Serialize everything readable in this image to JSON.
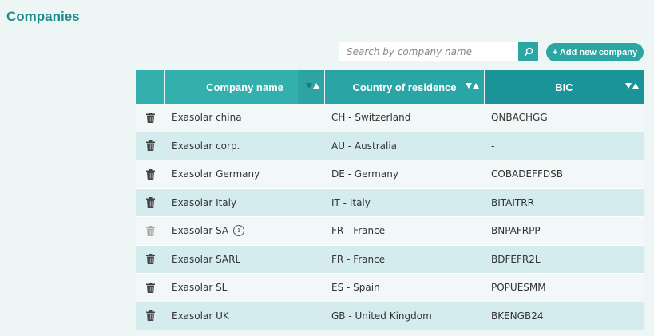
{
  "page": {
    "title": "Companies"
  },
  "toolbar": {
    "search_placeholder": "Search by company name",
    "add_label": "+ Add new company"
  },
  "colors": {
    "accent": "#2aa6a3",
    "title": "#1d8a8c",
    "row_alt": "#d5ecee",
    "row": "#f2f8f8"
  },
  "table": {
    "headers": {
      "name": "Company name",
      "country": "Country of residence",
      "bic": "BIC"
    },
    "rows": [
      {
        "name": "Exasolar china",
        "country": "CH - Switzerland",
        "bic": "QNBACHGG",
        "deletable": true,
        "info": false
      },
      {
        "name": "Exasolar corp.",
        "country": "AU - Australia",
        "bic": "-",
        "deletable": true,
        "info": false
      },
      {
        "name": "Exasolar Germany",
        "country": "DE - Germany",
        "bic": "COBADEFFDSB",
        "deletable": true,
        "info": false
      },
      {
        "name": "Exasolar Italy",
        "country": "IT - Italy",
        "bic": "BITAITRR",
        "deletable": true,
        "info": false
      },
      {
        "name": "Exasolar SA",
        "country": "FR - France",
        "bic": "BNPAFRPP",
        "deletable": false,
        "info": true
      },
      {
        "name": "Exasolar SARL",
        "country": "FR - France",
        "bic": "BDFEFR2L",
        "deletable": true,
        "info": false
      },
      {
        "name": "Exasolar SL",
        "country": "ES - Spain",
        "bic": "POPUESMM",
        "deletable": true,
        "info": false
      },
      {
        "name": "Exasolar UK",
        "country": "GB - United Kingdom",
        "bic": "BKENGB24",
        "deletable": true,
        "info": false
      }
    ]
  }
}
